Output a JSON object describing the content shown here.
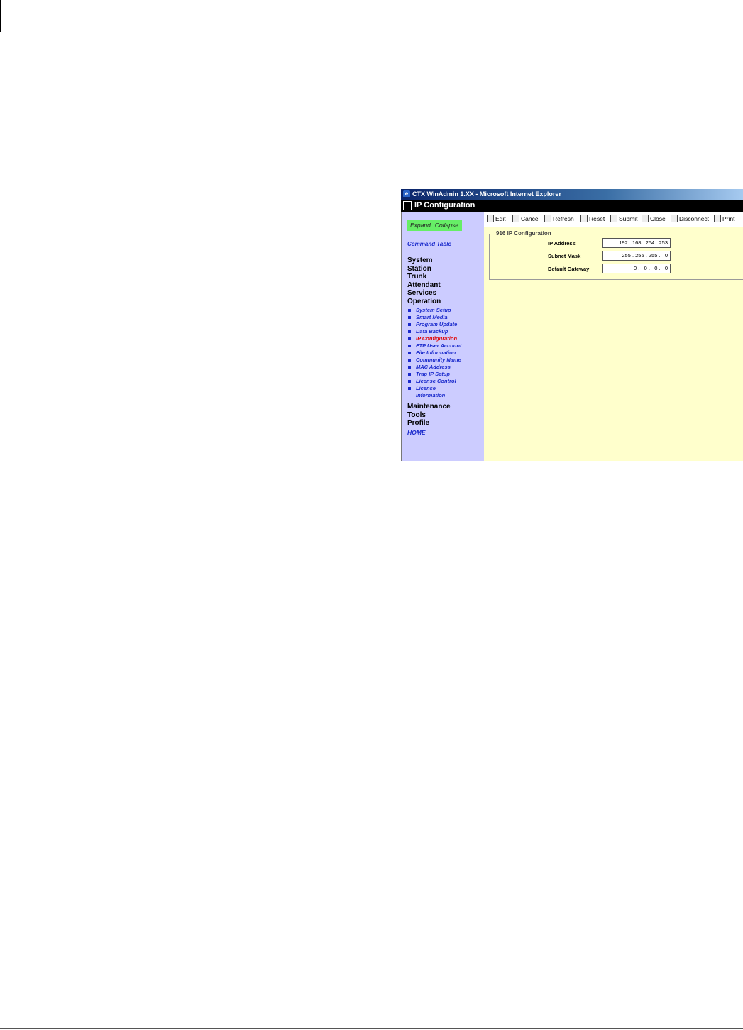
{
  "window": {
    "title": "CTX WinAdmin 1.XX - Microsoft Internet Explorer",
    "page_title": "IP Configuration"
  },
  "sidebar": {
    "expand": "Expand",
    "collapse": "Collapse",
    "command_table": "Command Table",
    "menu": [
      "System",
      "Station",
      "Trunk",
      "Attendant",
      "Services",
      "Operation"
    ],
    "operation_items": [
      "System Setup",
      "Smart Media",
      "Program Update",
      "Data Backup",
      "IP Configuration",
      "FTP User Account",
      "File Information",
      "Community Name",
      "MAC Address",
      "Trap IP Setup",
      "License Control",
      "License Information"
    ],
    "menu2": [
      "Maintenance",
      "Tools",
      "Profile"
    ],
    "home": "HOME"
  },
  "toolbar": {
    "edit": "Edit",
    "cancel": "Cancel",
    "refresh": "Refresh",
    "reset": "Reset",
    "submit": "Submit",
    "close": "Close",
    "disconnect": "Disconnect",
    "print": "Print"
  },
  "form": {
    "legend": "916 IP Configuration",
    "ip_address_label": "IP Address",
    "ip_address_value": "192 . 168 . 254 . 253",
    "subnet_mask_label": "Subnet Mask",
    "subnet_mask_value": "255 . 255 . 255 .   0",
    "gateway_label": "Default Gateway",
    "gateway_value": "0 .   0 .   0 .   0"
  }
}
